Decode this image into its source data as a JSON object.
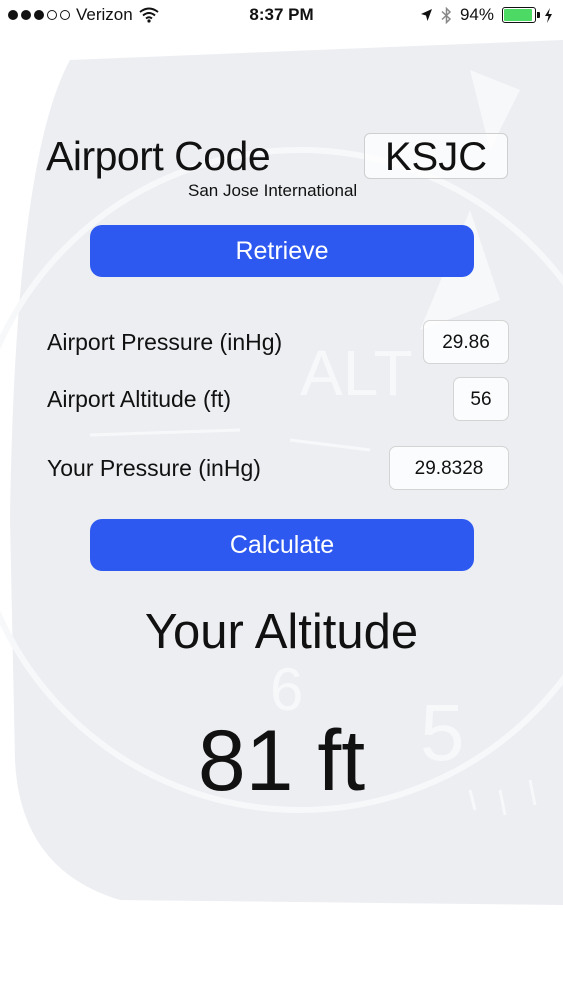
{
  "status_bar": {
    "carrier": "Verizon",
    "time": "8:37 PM",
    "battery_percent": "94%",
    "battery_level": 0.94,
    "signal_bars_filled": 3,
    "signal_bars_total": 5,
    "icons": [
      "wifi-icon",
      "location-arrow-icon",
      "bluetooth-icon",
      "battery-icon",
      "charging-bolt-icon"
    ]
  },
  "form": {
    "airport_code_label": "Airport Code",
    "airport_code_value": "KSJC",
    "airport_name": "San Jose International",
    "retrieve_label": "Retrieve",
    "airport_pressure_label": "Airport Pressure (inHg)",
    "airport_pressure_value": "29.86",
    "airport_altitude_label": "Airport Altitude (ft)",
    "airport_altitude_value": "56",
    "your_pressure_label": "Your Pressure (inHg)",
    "your_pressure_value": "29.8328",
    "calculate_label": "Calculate"
  },
  "result": {
    "title": "Your Altitude",
    "value": "81 ft"
  },
  "colors": {
    "button": "#2d59f0",
    "button_text": "#ffffff",
    "background_dial": "#eceef2",
    "battery_fill": "#4cd964"
  }
}
